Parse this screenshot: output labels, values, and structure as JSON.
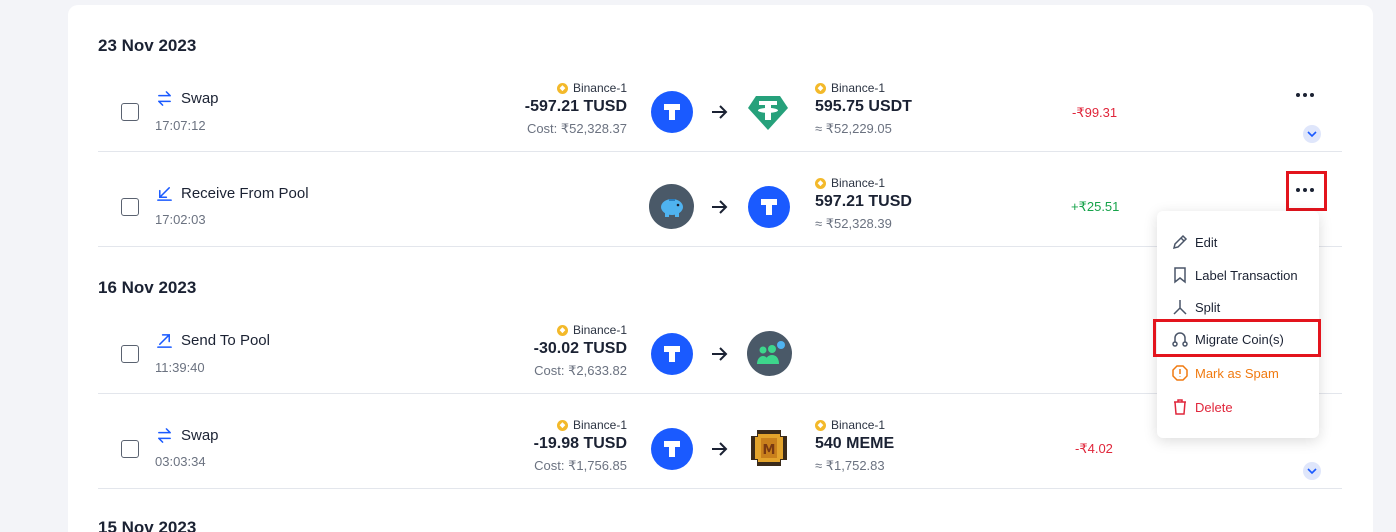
{
  "groups": [
    {
      "date": "23 Nov 2023"
    },
    {
      "date": "16 Nov 2023"
    },
    {
      "date": "15 Nov 2023"
    }
  ],
  "transactions": [
    {
      "type": "Swap",
      "time": "17:07:12",
      "from_network": "Binance-1",
      "from_amount": "-597.21 TUSD",
      "from_cost": "Cost: ₹52,328.37",
      "to_network": "Binance-1",
      "to_amount": "595.75 USDT",
      "to_value": "≈ ₹52,229.05",
      "pnl": "-₹99.31"
    },
    {
      "type": "Receive From Pool",
      "time": "17:02:03",
      "to_network": "Binance-1",
      "to_amount": "597.21 TUSD",
      "to_value": "≈ ₹52,328.39",
      "pnl": "+₹25.51"
    },
    {
      "type": "Send To Pool",
      "time": "11:39:40",
      "from_network": "Binance-1",
      "from_amount": "-30.02 TUSD",
      "from_cost": "Cost: ₹2,633.82"
    },
    {
      "type": "Swap",
      "time": "03:03:34",
      "from_network": "Binance-1",
      "from_amount": "-19.98 TUSD",
      "from_cost": "Cost: ₹1,756.85",
      "to_network": "Binance-1",
      "to_amount": "540 MEME",
      "to_value": "≈ ₹1,752.83",
      "pnl": "-₹4.02"
    }
  ],
  "context_menu": {
    "edit": "Edit",
    "label": "Label Transaction",
    "split": "Split",
    "migrate": "Migrate Coin(s)",
    "spam": "Mark as Spam",
    "delete": "Delete"
  },
  "colors": {
    "accent": "#1a5aff",
    "negative": "#e0263b",
    "positive": "#16a34a",
    "highlight": "#e3141d",
    "spam": "#f07a10"
  }
}
